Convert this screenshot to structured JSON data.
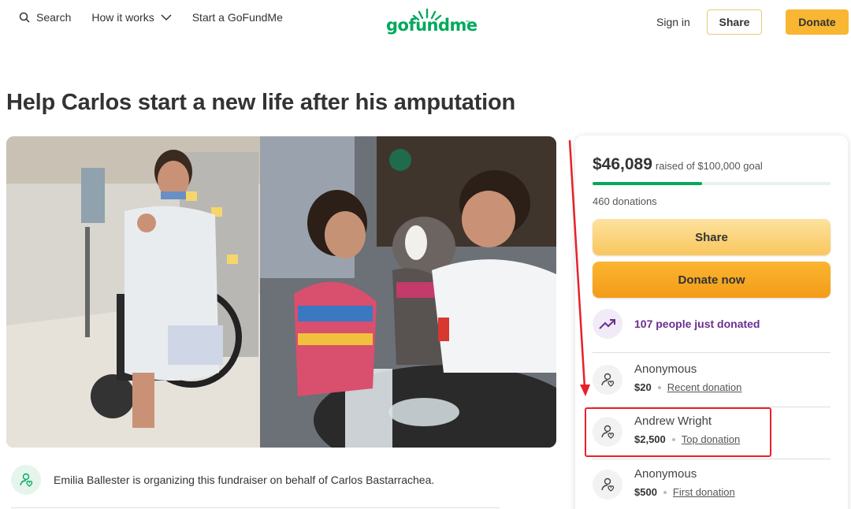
{
  "header": {
    "search_label": "Search",
    "how_it_works_label": "How it works",
    "start_label": "Start a GoFundMe",
    "logo_text": "gofundme",
    "logo_tm": "™",
    "signin_label": "Sign in",
    "share_label": "Share",
    "donate_label": "Donate"
  },
  "campaign": {
    "title": "Help Carlos start a new life after his amputation",
    "organizer_text": "Emilia Ballester is organizing this fundraiser on behalf of Carlos Bastarrachea."
  },
  "sidebar": {
    "raised_amount": "$46,089",
    "raised_goal": "raised of $100,000 goal",
    "progress_fraction": 0.46,
    "donations_count": "460 donations",
    "share_label": "Share",
    "donate_label": "Donate now",
    "trend_text": "107 people just donated",
    "donations": [
      {
        "name": "Anonymous",
        "amount": "$20",
        "tag": "Recent donation"
      },
      {
        "name": "Andrew Wright",
        "amount": "$2,500",
        "tag": "Top donation"
      },
      {
        "name": "Anonymous",
        "amount": "$500",
        "tag": "First donation"
      }
    ]
  },
  "colors": {
    "brand_green": "#02a95c",
    "donate_orange": "#f9b632",
    "trend_purple": "#6b2d91",
    "annotation_red": "#e8202a"
  },
  "icons": [
    "search-icon",
    "chevron-down-icon",
    "trending-up-icon",
    "donor-heart-icon"
  ]
}
